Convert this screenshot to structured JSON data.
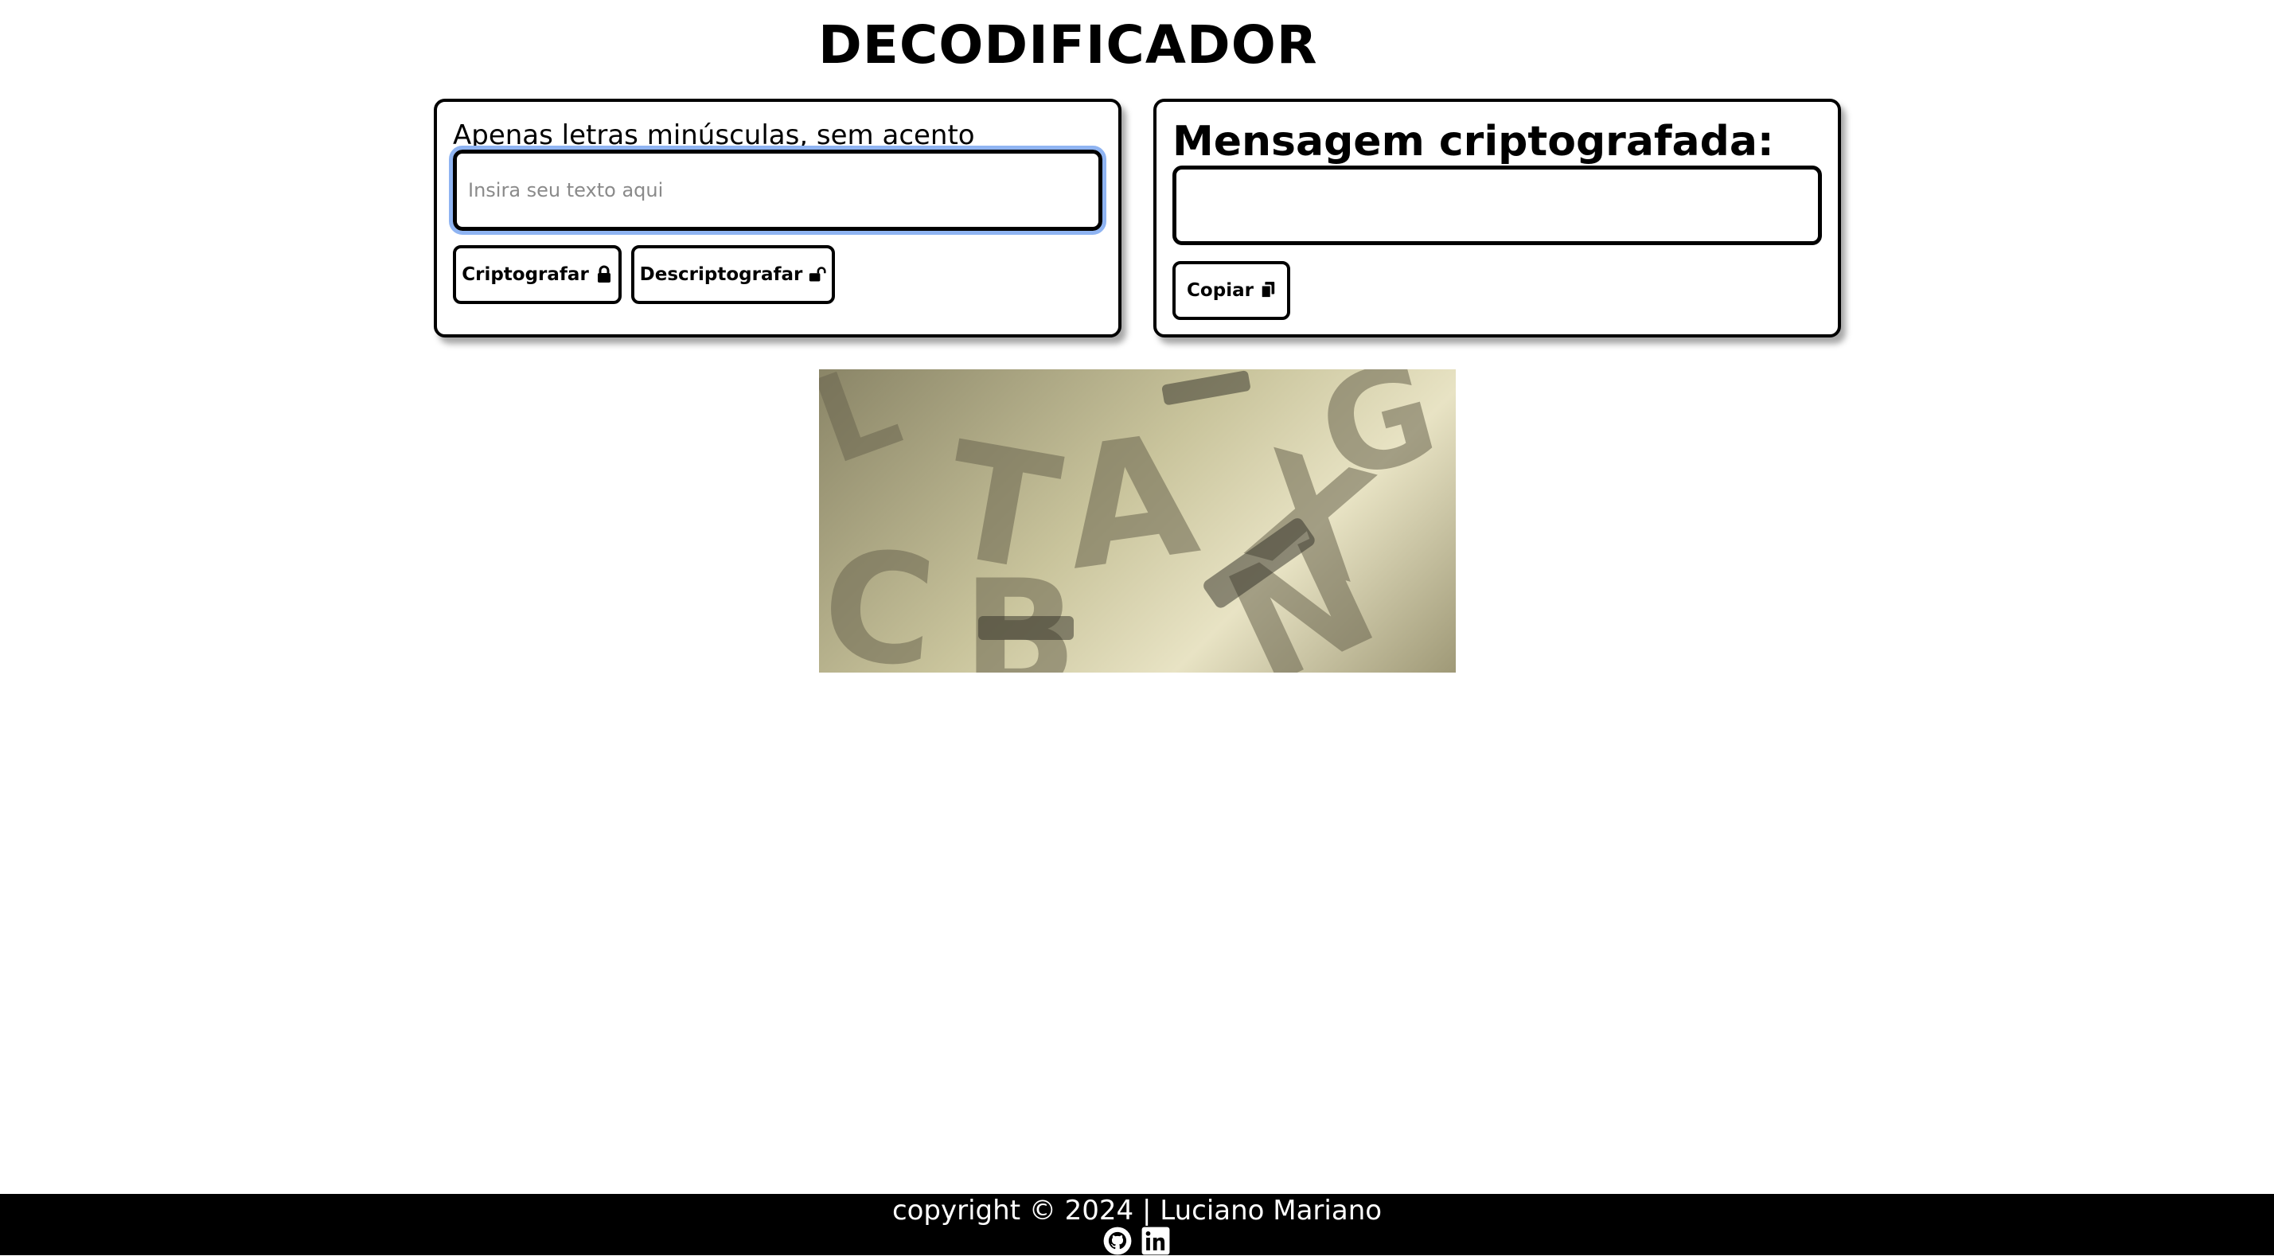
{
  "header": {
    "title": "DECODIFICADOR"
  },
  "input_panel": {
    "hint": "Apenas letras minúsculas, sem acento",
    "text_input": {
      "value": "",
      "placeholder": "Insira seu texto aqui"
    },
    "encrypt_label": "Criptografar",
    "decrypt_label": "Descriptografar"
  },
  "output_panel": {
    "title": "Mensagem criptografada:",
    "output_text": "",
    "copy_label": "Copiar"
  },
  "hero_image": {
    "description_icon": "wooden-letters-image"
  },
  "footer": {
    "copyright": "copyright © 2024 | Luciano Mariano",
    "links": [
      {
        "icon": "github-icon"
      },
      {
        "icon": "linkedin-icon"
      }
    ]
  },
  "colors": {
    "accent_focus": "#8fb4f2",
    "footer_bg": "#000000",
    "text": "#000000"
  }
}
